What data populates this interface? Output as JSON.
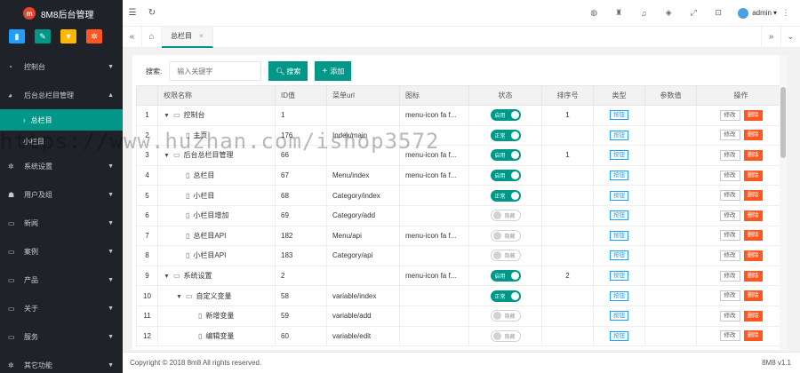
{
  "app": {
    "logo_letter": "m",
    "title": "8M8后台管理"
  },
  "quick_buttons": [
    {
      "icon": "signal-icon",
      "glyph": "▮",
      "color": "#1e9fff"
    },
    {
      "icon": "pencil-icon",
      "glyph": "✎",
      "color": "#009688"
    },
    {
      "icon": "shirt-icon",
      "glyph": "▼",
      "color": "#ffb800"
    },
    {
      "icon": "cogs-icon",
      "glyph": "✲",
      "color": "#ff5722"
    }
  ],
  "sidebar": {
    "items": [
      {
        "label": "控制台",
        "icon": "speedometer-icon",
        "glyph": "◔",
        "arrow": "▼"
      },
      {
        "label": "后台总栏目管理",
        "icon": "dashboard-icon",
        "glyph": "◕",
        "arrow": "▲"
      },
      {
        "label": "系统设置",
        "icon": "gear-icon",
        "glyph": "✲",
        "arrow": "▼"
      },
      {
        "label": "用户及组",
        "icon": "users-icon",
        "glyph": "☗",
        "arrow": "▼"
      },
      {
        "label": "新闻",
        "icon": "desktop-icon",
        "glyph": "▭",
        "arrow": "▼"
      },
      {
        "label": "案例",
        "icon": "desktop-icon",
        "glyph": "▭",
        "arrow": "▼"
      },
      {
        "label": "产品",
        "icon": "desktop-icon",
        "glyph": "▭",
        "arrow": "▼"
      },
      {
        "label": "关于",
        "icon": "desktop-icon",
        "glyph": "▭",
        "arrow": "▼"
      },
      {
        "label": "服务",
        "icon": "desktop-icon",
        "glyph": "▭",
        "arrow": "▼"
      },
      {
        "label": "其它功能",
        "icon": "gear-icon",
        "glyph": "✲",
        "arrow": "▼"
      }
    ],
    "sub_items": [
      {
        "label": "总栏目",
        "bullet": "›"
      },
      {
        "label": "小栏目",
        "bullet": ""
      }
    ]
  },
  "header": {
    "left_icons": [
      {
        "icon": "menu-toggle-icon",
        "glyph": "☰"
      },
      {
        "icon": "refresh-icon",
        "glyph": "↻"
      }
    ],
    "right_icons": [
      {
        "icon": "globe-icon",
        "glyph": "◍"
      },
      {
        "icon": "trash-icon",
        "glyph": "♜"
      },
      {
        "icon": "bell-icon",
        "glyph": "♫"
      },
      {
        "icon": "tag-icon",
        "glyph": "◈"
      },
      {
        "icon": "fullscreen-icon",
        "glyph": "⤢"
      },
      {
        "icon": "lock-icon",
        "glyph": "⊡"
      }
    ],
    "user": "admin",
    "user_caret": "▾",
    "more": "⋮"
  },
  "tabs": {
    "prev": "«",
    "home": "⌂",
    "active_label": "总栏目",
    "close": "×",
    "next": "»",
    "dropdown": "⌄"
  },
  "toolbar": {
    "search_label": "搜索:",
    "search_placeholder": "输入关键字",
    "search_button": "搜索",
    "search_icon": "🔍︎",
    "add_button": "添加",
    "add_icon": "+"
  },
  "table": {
    "columns": [
      "",
      "权限名称",
      "ID值",
      "菜单url",
      "图标",
      "状态",
      "排序号",
      "类型",
      "参数值",
      "操作"
    ],
    "rows": [
      {
        "no": "1",
        "depth": 0,
        "caret": "▼",
        "file": "folder",
        "name": "控制台",
        "id": "1",
        "url": "",
        "icon": "menu-icon fa f...",
        "status": "on",
        "status_text": "启用",
        "sort": "1",
        "type": "按钮",
        "param": ""
      },
      {
        "no": "2",
        "depth": 1,
        "caret": "",
        "file": "doc",
        "name": "主页",
        "id": "176",
        "url": "Index/main",
        "icon": "",
        "status": "on",
        "status_text": "正常",
        "sort": "",
        "type": "按钮",
        "param": ""
      },
      {
        "no": "3",
        "depth": 0,
        "caret": "▼",
        "file": "folder",
        "name": "后台总栏目管理",
        "id": "66",
        "url": "",
        "icon": "menu-icon fa f...",
        "status": "on",
        "status_text": "启用",
        "sort": "1",
        "type": "按钮",
        "param": ""
      },
      {
        "no": "4",
        "depth": 1,
        "caret": "",
        "file": "doc",
        "name": "总栏目",
        "id": "67",
        "url": "Menu/index",
        "icon": "menu-icon fa f...",
        "status": "on",
        "status_text": "启用",
        "sort": "",
        "type": "按钮",
        "param": ""
      },
      {
        "no": "5",
        "depth": 1,
        "caret": "",
        "file": "doc",
        "name": "小栏目",
        "id": "68",
        "url": "Category/index",
        "icon": "",
        "status": "on",
        "status_text": "正常",
        "sort": "",
        "type": "按钮",
        "param": ""
      },
      {
        "no": "6",
        "depth": 1,
        "caret": "",
        "file": "doc",
        "name": "小栏目增加",
        "id": "69",
        "url": "Category/add",
        "icon": "",
        "status": "off",
        "status_text": "隐藏",
        "sort": "",
        "type": "按钮",
        "param": ""
      },
      {
        "no": "7",
        "depth": 1,
        "caret": "",
        "file": "doc",
        "name": "总栏目API",
        "id": "182",
        "url": "Menu/api",
        "icon": "menu-icon fa f...",
        "status": "off",
        "status_text": "隐藏",
        "sort": "",
        "type": "按钮",
        "param": ""
      },
      {
        "no": "8",
        "depth": 1,
        "caret": "",
        "file": "doc",
        "name": "小栏目API",
        "id": "183",
        "url": "Category/api",
        "icon": "",
        "status": "off",
        "status_text": "隐藏",
        "sort": "",
        "type": "按钮",
        "param": ""
      },
      {
        "no": "9",
        "depth": 0,
        "caret": "▼",
        "file": "folder",
        "name": "系统设置",
        "id": "2",
        "url": "",
        "icon": "menu-icon fa f...",
        "status": "on",
        "status_text": "启用",
        "sort": "2",
        "type": "按钮",
        "param": ""
      },
      {
        "no": "10",
        "depth": 1,
        "caret": "▼",
        "file": "folder",
        "name": "自定义变量",
        "id": "58",
        "url": "variable/index",
        "icon": "",
        "status": "on",
        "status_text": "正常",
        "sort": "",
        "type": "按钮",
        "param": ""
      },
      {
        "no": "11",
        "depth": 2,
        "caret": "",
        "file": "doc",
        "name": "新增变量",
        "id": "59",
        "url": "variable/add",
        "icon": "",
        "status": "off",
        "status_text": "隐藏",
        "sort": "",
        "type": "按钮",
        "param": ""
      },
      {
        "no": "12",
        "depth": 2,
        "caret": "",
        "file": "doc",
        "name": "编辑变量",
        "id": "60",
        "url": "variable/edit",
        "icon": "",
        "status": "off",
        "status_text": "隐藏",
        "sort": "",
        "type": "按钮",
        "param": ""
      }
    ],
    "edit_label": "修改",
    "delete_label": "删除"
  },
  "footer": {
    "copyright": "Copyright © 2018 8m8 All rights reserved.",
    "version": "8M8 v1.1"
  },
  "watermark": "https://www.huzhan.com/ishop3572",
  "colors": {
    "accent": "#009688",
    "sidebar_bg": "#20222a",
    "danger": "#ff5722",
    "info": "#1e9fff"
  }
}
